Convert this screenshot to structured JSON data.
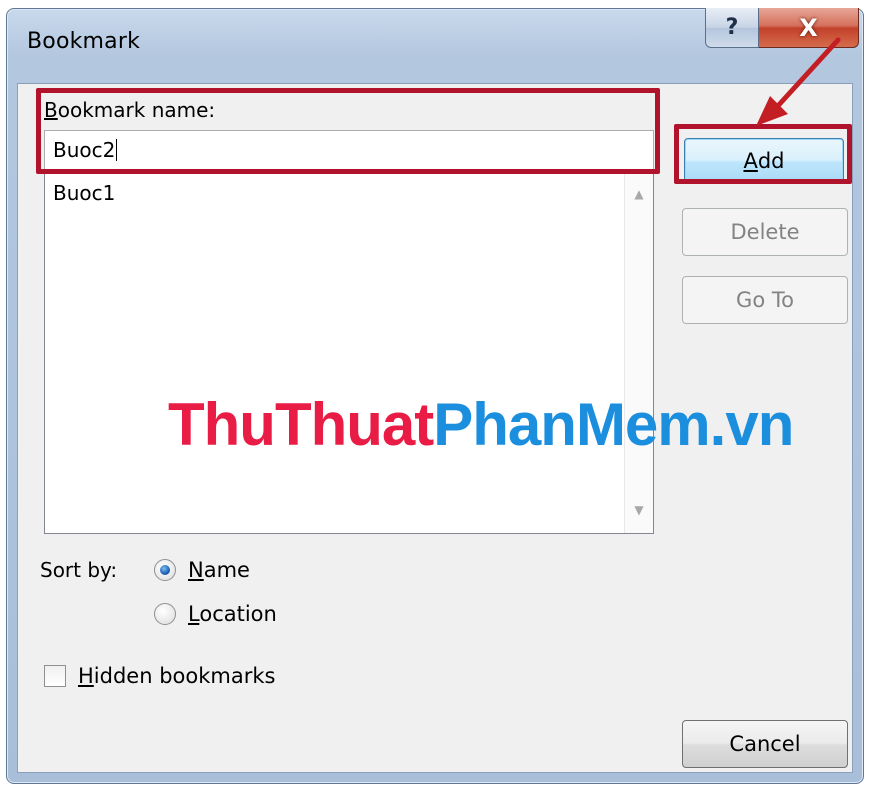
{
  "window": {
    "title": "Bookmark",
    "help_label": "?",
    "close_label": "X"
  },
  "form": {
    "name_label_prefix": "B",
    "name_label_rest": "ookmark name:",
    "name_value": "Buoc2",
    "list_items": [
      "Buoc1"
    ],
    "sort_by_label": "Sort by:",
    "sort_name_accel": "N",
    "sort_name_rest": "ame",
    "sort_location_accel": "L",
    "sort_location_rest": "ocation",
    "sort_selected": "Name",
    "hidden_accel": "H",
    "hidden_rest": "idden bookmarks",
    "hidden_checked": false
  },
  "buttons": {
    "add_accel": "A",
    "add_rest": "dd",
    "delete": "Delete",
    "goto": "Go To",
    "cancel": "Cancel"
  },
  "watermark": {
    "part1": "ThuThuat",
    "part2": "PhanMem.vn"
  },
  "colors": {
    "highlight": "#b0132b",
    "watermark_red": "#e81c45",
    "watermark_blue": "#1b8ede",
    "arrow": "#c41e25"
  },
  "icons": {
    "help": "question-mark-icon",
    "close": "close-x-icon",
    "scroll_up": "triangle-up-icon",
    "scroll_down": "triangle-down-icon"
  }
}
